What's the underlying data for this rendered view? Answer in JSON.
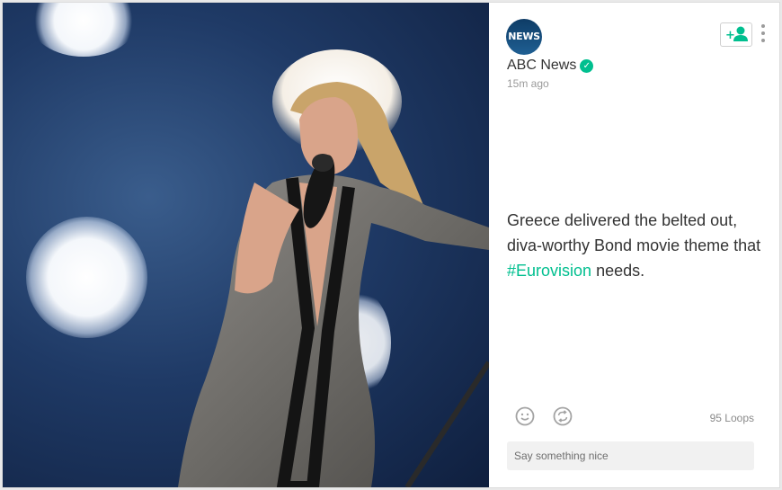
{
  "post": {
    "author": "ABC News",
    "logo_text": "NEWS",
    "timestamp": "15m ago",
    "description_prefix": "Greece delivered the belted out, diva-worthy Bond movie theme that ",
    "hashtag": "#Eurovision",
    "description_suffix": " needs.",
    "loops": "95 Loops"
  },
  "comment": {
    "placeholder": "Say something nice"
  },
  "icons": {
    "follow": "add-user-icon",
    "more": "more-vertical-icon",
    "like": "smiley-icon",
    "revine": "revine-icon",
    "verified": "verified-badge-icon"
  },
  "colors": {
    "accent": "#00bf8f",
    "text": "#333333",
    "muted": "#9a9a9a"
  }
}
